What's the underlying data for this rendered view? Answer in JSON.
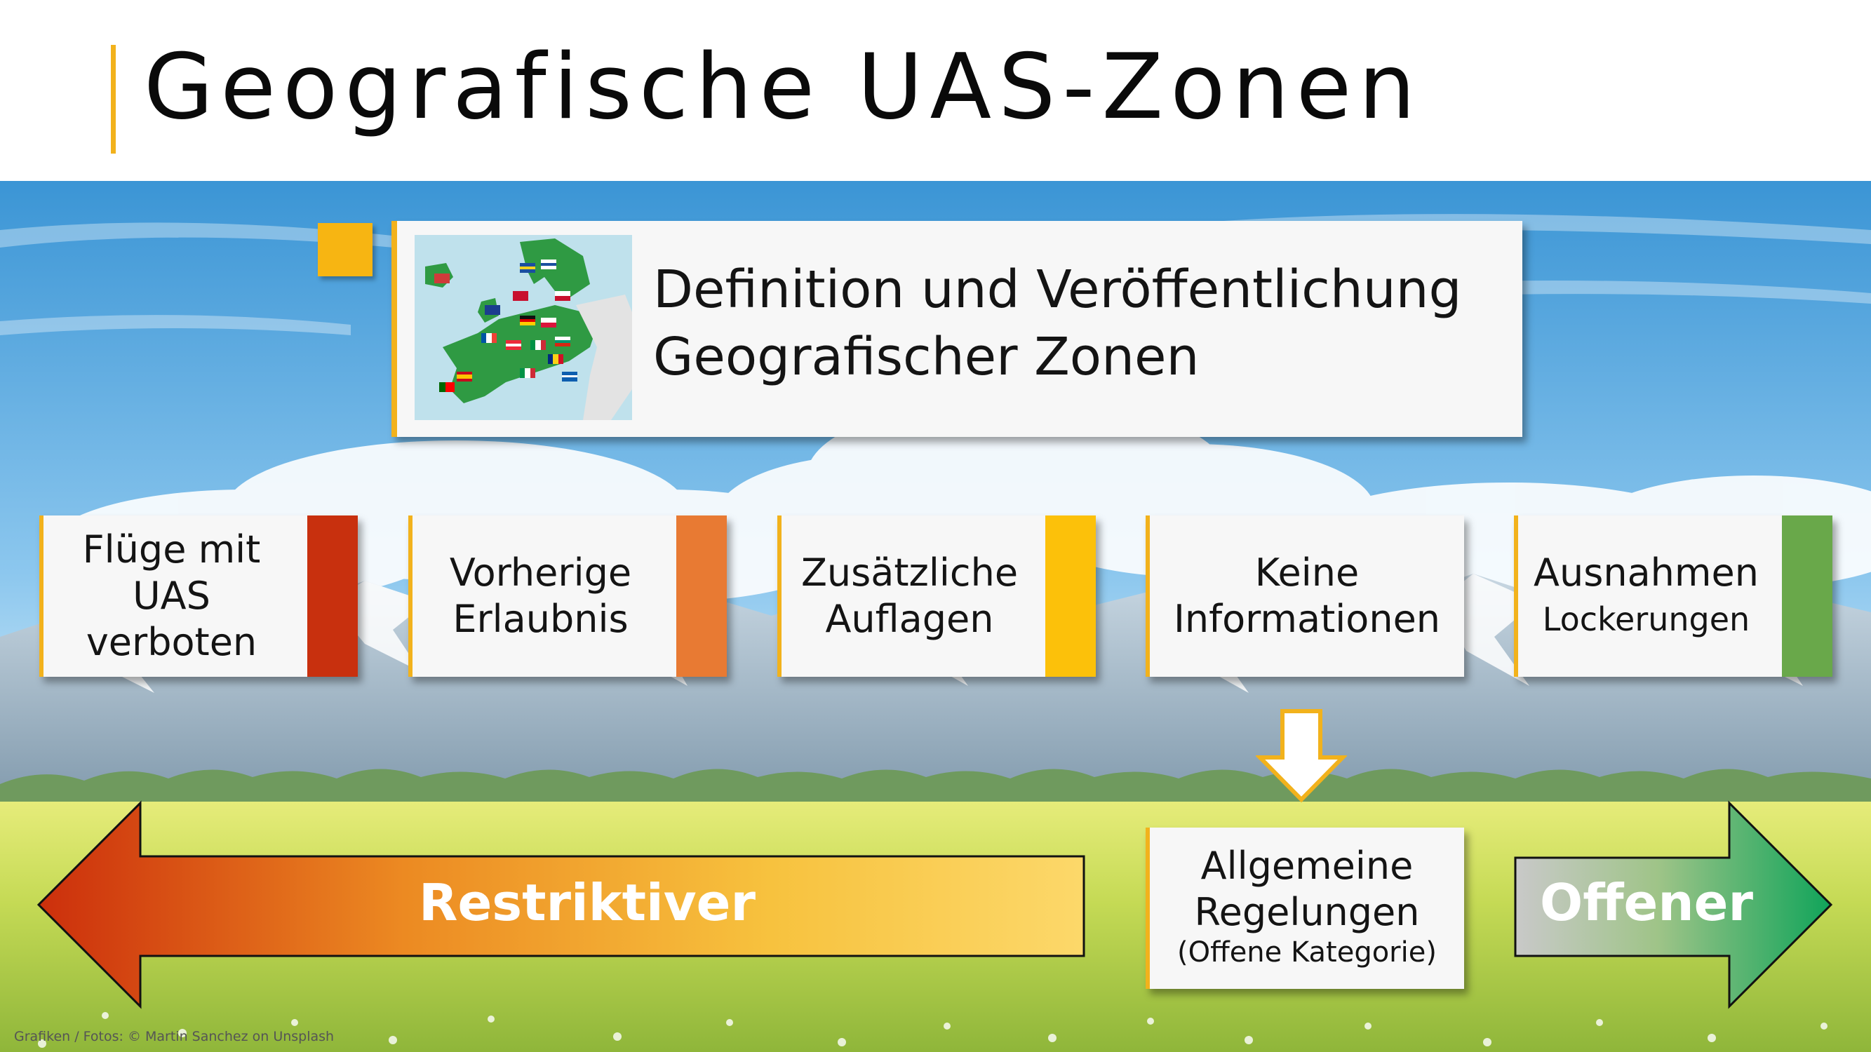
{
  "title": "Geografische UAS-Zonen",
  "definition": {
    "line1": "Definition und Veröffentlichung",
    "line2": "Geografischer Zonen",
    "map_icon": "europe-map-with-flags"
  },
  "zones": [
    {
      "line1": "Flüge mit",
      "line2": "UAS",
      "line3": "verboten",
      "color": "#c8300e"
    },
    {
      "line1": "Vorherige",
      "line2": "Erlaubnis",
      "color": "#e87a33"
    },
    {
      "line1": "Zusätzliche",
      "line2": "Auflagen",
      "color": "#fcc10a"
    },
    {
      "line1": "Keine",
      "line2": "Informationen",
      "color": ""
    },
    {
      "line1": "Ausnahmen",
      "line2": "Lockerungen",
      "color": "#69a84a"
    }
  ],
  "general": {
    "line1": "Allgemeine",
    "line2": "Regelungen",
    "sub": "(Offene Kategorie)"
  },
  "arrows": {
    "left": "Restriktiver",
    "right": "Offener"
  },
  "credit": "Grafiken / Fotos: © Martin Sanchez on Unsplash",
  "colors": {
    "accent": "#f2b21c",
    "sky_top": "#3e97d6",
    "grass": "#b5d24a"
  }
}
